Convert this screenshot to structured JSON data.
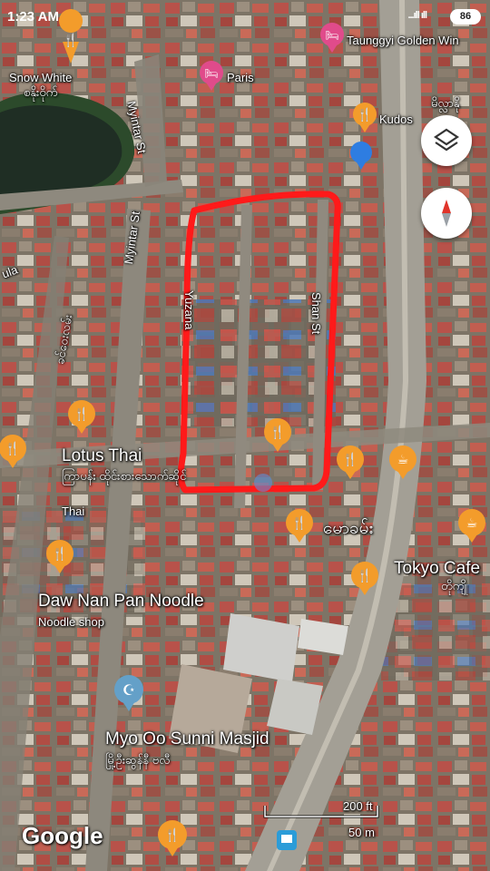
{
  "status_bar": {
    "time": "1:23 AM",
    "signal": "...ıll ıll",
    "battery": "86"
  },
  "places": {
    "snow_white": "Snow White",
    "snow_white_my": "စနိုးဝိုက်",
    "paris": "Paris",
    "taunggyi_golden_win": "Taunggyi Golden Win",
    "kudos": "Kudos",
    "kudos_my": "မိလ္လာနို",
    "lotus_thai": "Lotus Thai",
    "lotus_thai_my": "ကြာပန်း ထိုင်းစားသောက်ဆိုင်",
    "lotus_thai_sub": "Thai",
    "mao_my": "မောခမ်း",
    "tokyo_cafe": "Tokyo Cafe",
    "tokyo_cafe_my": "တိုကျို",
    "daw_nan_pan": "Daw Nan Pan Noodle",
    "daw_nan_pan_sub": "Noodle shop",
    "myo_oo": "Myo Oo Sunni Masjid",
    "myo_oo_my": "မြို့ဦးဆွန်နီ ဗလီ"
  },
  "streets": {
    "myintar_1": "Myintar St",
    "myintar_2": "Myintar St",
    "shan": "Shan St",
    "nula": "ula",
    "my_street": "ခင်ဝေးလမ်း",
    "street3": "Yuzana"
  },
  "scale": {
    "feet": "200 ft",
    "meters": "50 m"
  },
  "brand": "Google",
  "controls": {
    "layers": "layers-icon",
    "compass": "compass-icon"
  },
  "colors": {
    "pin": "#f39c2b",
    "pink_pin": "#e04b8b",
    "blue_pin": "#2e7de1",
    "teal_pin": "#64a0c8",
    "highlight": "#ff1a1a"
  }
}
